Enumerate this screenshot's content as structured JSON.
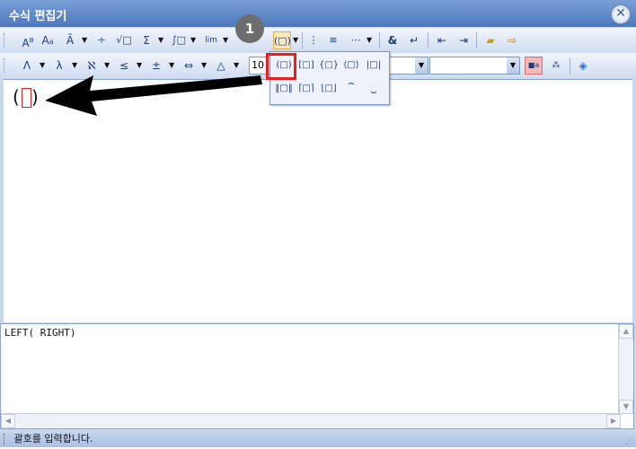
{
  "window": {
    "title": "수식 편집기",
    "close_icon": "close-icon"
  },
  "toolbar1": {
    "buttons": [
      "superscript-icon",
      "case-icon",
      "accent-icon",
      "fraction-icon",
      "root-icon",
      "sum-icon",
      "integral-icon",
      "limit-icon",
      "bracket-icon",
      "matrix-icon",
      "pile-icon",
      "grid-icon",
      "ampersand-icon",
      "enter-icon",
      "align-left-icon",
      "align-right-icon",
      "open-file-icon",
      "exit-icon"
    ]
  },
  "toolbar2": {
    "symbols": [
      "Λ",
      "λ",
      "ℵ",
      "≤",
      "±",
      "⇔",
      "△"
    ],
    "font_size": "10"
  },
  "bracket_popup": {
    "items_row1": [
      "(□)",
      "[□]",
      "{□}",
      "⟨□⟩",
      "|□|"
    ],
    "items_row2": [
      "‖□‖",
      "⌈□⌉",
      "⌊□⌋",
      "⏞",
      "⏟"
    ]
  },
  "callout": {
    "step_number": "1"
  },
  "editor": {
    "left_paren": "(",
    "right_paren": ")"
  },
  "script": {
    "text": "LEFT(  RIGHT)"
  },
  "status": {
    "text": "괄호를 입력합니다."
  },
  "colors": {
    "highlight": "#ee1b1b",
    "titlebar": "#4d78bd",
    "badge": "#6d6d6d"
  }
}
